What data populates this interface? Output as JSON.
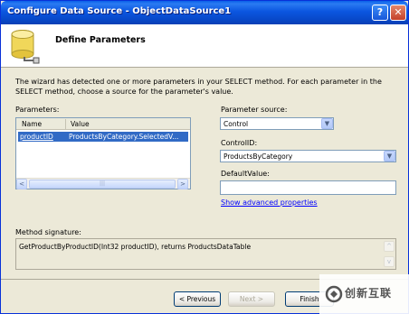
{
  "window": {
    "title": "Configure Data Source - ObjectDataSource1"
  },
  "titlebar": {
    "help_glyph": "?",
    "close_glyph": "✕"
  },
  "header": {
    "title": "Define Parameters",
    "icon": "database-plug-icon"
  },
  "description": "The wizard has detected one or more parameters in your SELECT method. For each parameter in the SELECT method, choose a source for the parameter's value.",
  "parameters": {
    "label": "Parameters:",
    "columns": [
      "Name",
      "Value"
    ],
    "rows": [
      {
        "name": "productID",
        "value": "ProductsByCategory.SelectedV..."
      }
    ],
    "scroll_left": "<",
    "scroll_right": ">",
    "thumb_grip": "|||"
  },
  "parameter_source": {
    "label": "Parameter source:",
    "selected": "Control"
  },
  "control_id": {
    "label": "ControlID:",
    "selected": "ProductsByCategory"
  },
  "default_value": {
    "label": "DefaultValue:",
    "value": ""
  },
  "advanced_link": "Show advanced properties",
  "method_signature": {
    "label": "Method signature:",
    "text": "GetProductByProductID(Int32 productID), returns ProductsDataTable"
  },
  "buttons": {
    "previous": "< Previous",
    "next": "Next >",
    "finish": "Finish"
  },
  "watermark": {
    "text": "创新互联"
  },
  "colors": {
    "title_bar": "#0b56e0",
    "selection": "#316ac5",
    "link": "#0000ff",
    "dialog_bg": "#ece9d8"
  }
}
